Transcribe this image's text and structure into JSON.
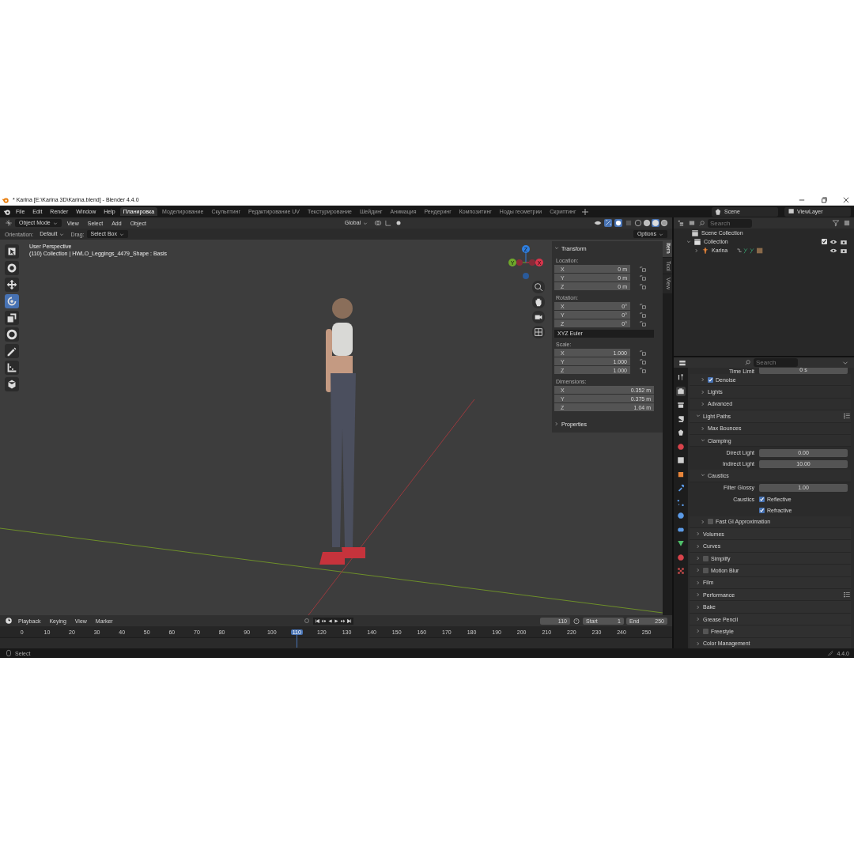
{
  "window": {
    "title": "* Karina [E:\\Karina 3D\\Karina.blend] - Blender 4.4.0"
  },
  "menu": [
    "File",
    "Edit",
    "Render",
    "Window",
    "Help"
  ],
  "workspaces": [
    {
      "label": "Планировка",
      "selected": true
    },
    {
      "label": "Моделирование",
      "selected": false
    },
    {
      "label": "Скульптинг",
      "selected": false
    },
    {
      "label": "Редактирование UV",
      "selected": false
    },
    {
      "label": "Текстурирование",
      "selected": false
    },
    {
      "label": "Шейдинг",
      "selected": false
    },
    {
      "label": "Анимация",
      "selected": false
    },
    {
      "label": "Рендеринг",
      "selected": false
    },
    {
      "label": "Композитинг",
      "selected": false
    },
    {
      "label": "Ноды геометрии",
      "selected": false
    },
    {
      "label": "Скриптинг",
      "selected": false
    }
  ],
  "scene": "Scene",
  "view_layer": "ViewLayer",
  "viewport_header": {
    "mode": "Object Mode",
    "menus": [
      "View",
      "Select",
      "Add",
      "Object"
    ],
    "transform_orientation": "Global",
    "shading_modes": [
      {
        "kind": "wireframe",
        "selected": false
      },
      {
        "kind": "solid",
        "selected": false
      },
      {
        "kind": "material",
        "selected": true
      },
      {
        "kind": "rendered",
        "selected": false
      }
    ]
  },
  "tool_settings": {
    "orientation_label": "Orientation:",
    "orientation": "Default",
    "drag_label": "Drag:",
    "drag": "Select Box",
    "options": "Options"
  },
  "viewport": {
    "view_name": "User Perspective",
    "object_info": "(110) Collection | HWLO_Leggings_4479_Shape : Basis"
  },
  "tools": [
    {
      "kind": "select",
      "selected": false
    },
    {
      "kind": "cursor",
      "selected": false
    },
    {
      "kind": "move",
      "selected": false
    },
    {
      "kind": "rotate",
      "selected": true
    },
    {
      "kind": "scale",
      "selected": false
    },
    {
      "kind": "transform",
      "selected": false
    },
    {
      "kind": "annotate",
      "selected": false
    },
    {
      "kind": "measure",
      "selected": false
    },
    {
      "kind": "add_cube",
      "selected": false
    }
  ],
  "gizmo": {
    "axes": [
      {
        "label": "Z",
        "color": "#2f7fe0"
      },
      {
        "label": "Y",
        "color": "#6fa82b"
      },
      {
        "label": "X",
        "color": "#d8344b"
      }
    ]
  },
  "sidebar": {
    "tabs": [
      {
        "label": "Item",
        "selected": true
      },
      {
        "label": "Tool",
        "selected": false
      },
      {
        "label": "View",
        "selected": false
      }
    ],
    "title": "Transform",
    "expanded": true,
    "groups": [
      {
        "label": "Location:",
        "fields": [
          {
            "axis": "X",
            "value": "0 m",
            "locked": false
          },
          {
            "axis": "Y",
            "value": "0 m",
            "locked": false
          },
          {
            "axis": "Z",
            "value": "0 m",
            "locked": false
          }
        ]
      },
      {
        "label": "Rotation:",
        "fields": [
          {
            "axis": "X",
            "value": "0°",
            "locked": false
          },
          {
            "axis": "Y",
            "value": "0°",
            "locked": false
          },
          {
            "axis": "Z",
            "value": "0°",
            "locked": false
          }
        ],
        "mode": "XYZ Euler"
      },
      {
        "label": "Scale:",
        "fields": [
          {
            "axis": "X",
            "value": "1.000",
            "locked": false
          },
          {
            "axis": "Y",
            "value": "1.000",
            "locked": false
          },
          {
            "axis": "Z",
            "value": "1.000",
            "locked": false
          }
        ]
      },
      {
        "label": "Dimensions:",
        "fields": [
          {
            "axis": "X",
            "value": "0.352 m"
          },
          {
            "axis": "Y",
            "value": "0.375 m"
          },
          {
            "axis": "Z",
            "value": "1.04 m"
          }
        ]
      }
    ],
    "properties_panel": {
      "label": "Properties",
      "expanded": false
    }
  },
  "outliner": {
    "search_placeholder": "Search",
    "root": "Scene Collection",
    "items": [
      {
        "label": "Collection",
        "expanded": true,
        "checked": true,
        "children": [
          {
            "label": "Karina",
            "expanded": false
          }
        ]
      }
    ]
  },
  "properties": {
    "search_placeholder": "Search",
    "tabs": [
      {
        "kind": "tool",
        "selected": false
      },
      {
        "kind": "render",
        "selected": true
      },
      {
        "kind": "output",
        "selected": false
      },
      {
        "kind": "view_layer",
        "selected": false
      },
      {
        "kind": "scene",
        "selected": false
      },
      {
        "kind": "world",
        "selected": false
      },
      {
        "kind": "collection",
        "selected": false
      },
      {
        "kind": "object",
        "selected": false
      },
      {
        "kind": "modifier",
        "selected": false
      },
      {
        "kind": "particles",
        "selected": false
      },
      {
        "kind": "physics",
        "selected": false
      },
      {
        "kind": "constraints",
        "selected": false
      },
      {
        "kind": "data",
        "selected": false
      },
      {
        "kind": "material",
        "selected": false
      },
      {
        "kind": "texture",
        "selected": false
      }
    ],
    "rows": [
      {
        "kind": "field",
        "label": "Time Limit",
        "value": "0 s"
      },
      {
        "kind": "sub",
        "label": "Denoise",
        "expanded": false,
        "checked": true
      },
      {
        "kind": "sub",
        "label": "Lights",
        "expanded": false
      },
      {
        "kind": "sub",
        "label": "Advanced",
        "expanded": false
      },
      {
        "kind": "panel",
        "label": "Light Paths",
        "expanded": true,
        "presets": true
      },
      {
        "kind": "sub",
        "label": "Max Bounces",
        "expanded": false
      },
      {
        "kind": "sub",
        "label": "Clamping",
        "expanded": true
      },
      {
        "kind": "field",
        "label": "Direct Light",
        "value": "0.00"
      },
      {
        "kind": "field",
        "label": "Indirect Light",
        "value": "10.00"
      },
      {
        "kind": "sub",
        "label": "Caustics",
        "expanded": true
      },
      {
        "kind": "field",
        "label": "Filter Glossy",
        "value": "1.00"
      },
      {
        "kind": "check",
        "label": "Caustics",
        "text": "Reflective",
        "checked": true
      },
      {
        "kind": "check",
        "text": "Refractive",
        "checked": true
      },
      {
        "kind": "sub",
        "label": "Fast GI Approximation",
        "expanded": false,
        "checked": false
      },
      {
        "kind": "panel",
        "label": "Volumes",
        "expanded": false
      },
      {
        "kind": "panel",
        "label": "Curves",
        "expanded": false
      },
      {
        "kind": "panel",
        "label": "Simplify",
        "expanded": false,
        "checked": false
      },
      {
        "kind": "panel",
        "label": "Motion Blur",
        "expanded": false,
        "checked": false
      },
      {
        "kind": "panel",
        "label": "Film",
        "expanded": false
      },
      {
        "kind": "panel",
        "label": "Performance",
        "expanded": false,
        "presets": true
      },
      {
        "kind": "panel",
        "label": "Bake",
        "expanded": false
      },
      {
        "kind": "panel",
        "label": "Grease Pencil",
        "expanded": false
      },
      {
        "kind": "panel",
        "label": "Freestyle",
        "expanded": false,
        "checked": false
      },
      {
        "kind": "panel",
        "label": "Color Management",
        "expanded": false
      }
    ]
  },
  "timeline": {
    "menus": [
      "Playback",
      "Keying",
      "View",
      "Marker"
    ],
    "current_frame": "110",
    "start_label": "Start",
    "start": "1",
    "end_label": "End",
    "end": "250",
    "frames": [
      {
        "label": "0",
        "selected": false
      },
      {
        "label": "10",
        "selected": false
      },
      {
        "label": "20",
        "selected": false
      },
      {
        "label": "30",
        "selected": false
      },
      {
        "label": "40",
        "selected": false
      },
      {
        "label": "50",
        "selected": false
      },
      {
        "label": "60",
        "selected": false
      },
      {
        "label": "70",
        "selected": false
      },
      {
        "label": "80",
        "selected": false
      },
      {
        "label": "90",
        "selected": false
      },
      {
        "label": "100",
        "selected": false
      },
      {
        "label": "110",
        "selected": true
      },
      {
        "label": "120",
        "selected": false
      },
      {
        "label": "130",
        "selected": false
      },
      {
        "label": "140",
        "selected": false
      },
      {
        "label": "150",
        "selected": false
      },
      {
        "label": "160",
        "selected": false
      },
      {
        "label": "170",
        "selected": false
      },
      {
        "label": "180",
        "selected": false
      },
      {
        "label": "190",
        "selected": false
      },
      {
        "label": "200",
        "selected": false
      },
      {
        "label": "210",
        "selected": false
      },
      {
        "label": "220",
        "selected": false
      },
      {
        "label": "230",
        "selected": false
      },
      {
        "label": "240",
        "selected": false
      },
      {
        "label": "250",
        "selected": false
      }
    ]
  },
  "status_bar": {
    "action": "Select",
    "version": "4.4.0"
  }
}
